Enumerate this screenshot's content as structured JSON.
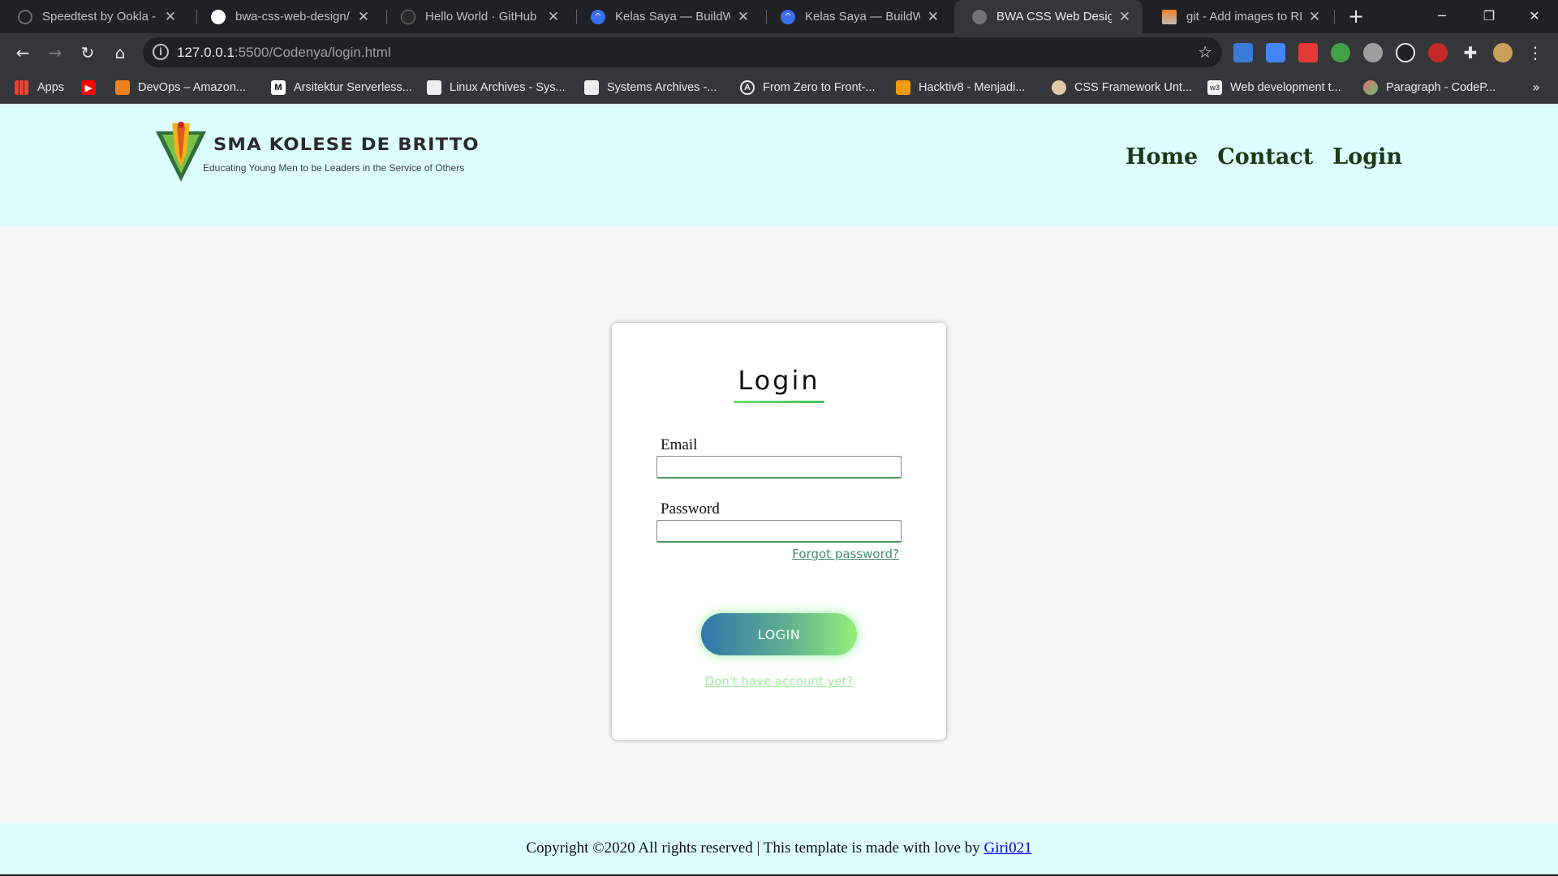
{
  "browser": {
    "tabs": [
      {
        "title": "Speedtest by Ookla - Th",
        "icon": "speedtest-icon",
        "color": "#3b3b3b"
      },
      {
        "title": "bwa-css-web-design/R",
        "icon": "github-icon",
        "color": "#ffffff"
      },
      {
        "title": "Hello World · GitHub G",
        "icon": "github-icon",
        "color": "#2a2a2a"
      },
      {
        "title": "Kelas Saya — BuildWith",
        "icon": "buildwith-icon",
        "color": "#3a6ff0"
      },
      {
        "title": "Kelas Saya — BuildWith",
        "icon": "buildwith-icon",
        "color": "#3a6ff0"
      },
      {
        "title": "BWA CSS Web Design",
        "icon": "globe-icon",
        "color": "#6f7378"
      },
      {
        "title": "git - Add images to RE",
        "icon": "stackoverflow-icon",
        "color": "#f48024"
      }
    ],
    "url_host": "127.0.0.1",
    "url_path": ":5500/Codenya/login.html",
    "bookmarks": [
      {
        "label": "Apps",
        "icon": "apps-grid-icon"
      },
      {
        "label": "",
        "icon": "youtube-icon"
      },
      {
        "label": "DevOps – Amazon...",
        "icon": "aws-icon"
      },
      {
        "label": "Arsitektur Serverless...",
        "icon": "medium-icon"
      },
      {
        "label": "Linux Archives - Sys...",
        "icon": "site-icon"
      },
      {
        "label": "Systems Archives -...",
        "icon": "site-icon"
      },
      {
        "label": "From Zero to Front-...",
        "icon": "angular-icon"
      },
      {
        "label": "Hacktiv8 - Menjadi...",
        "icon": "hacktiv8-icon"
      },
      {
        "label": "CSS Framework Unt...",
        "icon": "skull-icon"
      },
      {
        "label": "Web development t...",
        "icon": "w3-icon"
      },
      {
        "label": "Paragraph - CodeP...",
        "icon": "codepen-icon"
      }
    ],
    "more_bookmarks": "»"
  },
  "header": {
    "logo_title": "SMA KOLESE DE BRITTO",
    "logo_tagline": "Educating Young Men to be Leaders in the Service of Others",
    "nav": {
      "home": "Home",
      "contact": "Contact",
      "login": "Login"
    }
  },
  "login_form": {
    "title": "Login",
    "email_label": "Email",
    "email_value": "",
    "password_label": "Password",
    "password_value": "",
    "forgot_link": "Forgot password?",
    "submit_label": "LOGIN",
    "signup_link": "Don't have account yet?"
  },
  "footer": {
    "text": "Copyright ©2020 All rights reserved | This template is made with love by ",
    "author_link": "Giri021"
  },
  "colors": {
    "header_bg": "#dcfdff",
    "nav_text": "#1d3a16",
    "accent_green": "#48c25c",
    "button_start": "#2f76ad",
    "button_end": "#94ef7a"
  }
}
